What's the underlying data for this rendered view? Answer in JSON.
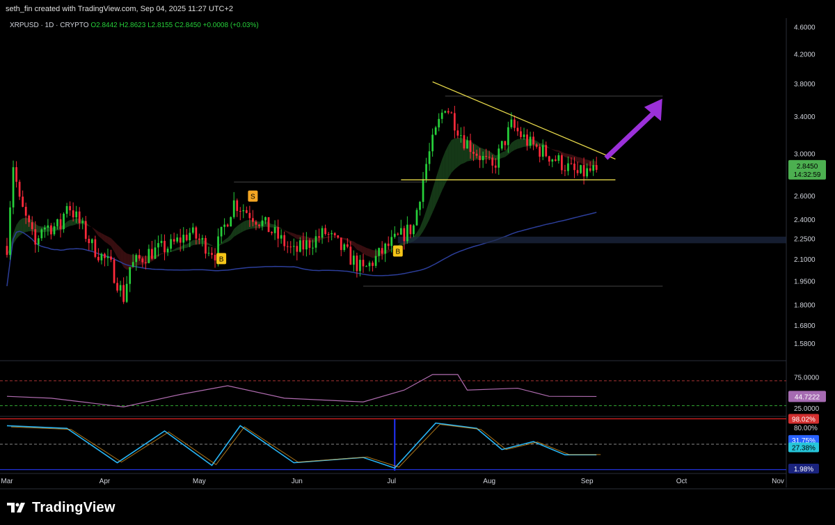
{
  "header": {
    "credit": "seth_fin created with TradingView.com, Sep 04, 2025 11:27 UTC+2"
  },
  "footer": {
    "brand": "TradingView",
    "logo_icon": "tradingview-logo-icon"
  },
  "colors": {
    "background": "#000000",
    "up": "#26d03a",
    "down": "#ff2a3b",
    "ema_fast": "#2e7d32",
    "ema_slow": "#7b1f23",
    "ma200": "#2c3e9a",
    "triangle": "#e6d84a",
    "arrow": "#9b30d9",
    "rsi_line": "#b06cb0",
    "rsi_tag_bg": "#a66bb2",
    "price_tag_bg": "#4caf50",
    "buy_signal": "#f5c518",
    "sell_signal": "#f5a623"
  },
  "chart_data": [
    {
      "type": "candlestick",
      "symbol_line": {
        "symbol": "XRPUSD · 1D · CRYPTO",
        "open": "O2.8442",
        "high": "H2.8623",
        "low": "L2.8155",
        "close": "C2.8450",
        "change": "+0.0008 (+0.03%)"
      },
      "y_scale": "log",
      "ylim": [
        1.5,
        4.75
      ],
      "y_ticks": [
        "4.6000",
        "4.2000",
        "3.8000",
        "3.4000",
        "3.0000",
        "2.6000",
        "2.4000",
        "2.2500",
        "2.1000",
        "1.9500",
        "1.8000",
        "1.6800",
        "1.5800"
      ],
      "x_ticks": [
        "Mar",
        "Apr",
        "May",
        "Jun",
        "Jul",
        "Aug",
        "Sep",
        "Oct",
        "Nov"
      ],
      "last_price": "2.8450",
      "countdown": "14:32:59",
      "signals": [
        {
          "label": "B",
          "date": "2025-05-08",
          "kind": "buy"
        },
        {
          "label": "S",
          "date": "2025-05-18",
          "kind": "sell"
        },
        {
          "label": "B",
          "date": "2025-07-03",
          "kind": "buy"
        }
      ],
      "levels": [
        2.73,
        2.25,
        1.92,
        3.65
      ],
      "closes": [
        {
          "d": "2025-03-01",
          "c": 2.2
        },
        {
          "d": "2025-03-03",
          "c": 2.9
        },
        {
          "d": "2025-03-05",
          "c": 2.55
        },
        {
          "d": "2025-03-10",
          "c": 2.2
        },
        {
          "d": "2025-03-12",
          "c": 2.35
        },
        {
          "d": "2025-03-18",
          "c": 2.35
        },
        {
          "d": "2025-03-20",
          "c": 2.55
        },
        {
          "d": "2025-03-28",
          "c": 2.2
        },
        {
          "d": "2025-04-03",
          "c": 2.05
        },
        {
          "d": "2025-04-07",
          "c": 1.85
        },
        {
          "d": "2025-04-09",
          "c": 2.05
        },
        {
          "d": "2025-04-15",
          "c": 2.15
        },
        {
          "d": "2025-04-22",
          "c": 2.2
        },
        {
          "d": "2025-04-28",
          "c": 2.3
        },
        {
          "d": "2025-05-06",
          "c": 2.15
        },
        {
          "d": "2025-05-12",
          "c": 2.55
        },
        {
          "d": "2025-05-20",
          "c": 2.4
        },
        {
          "d": "2025-05-31",
          "c": 2.15
        },
        {
          "d": "2025-06-10",
          "c": 2.3
        },
        {
          "d": "2025-06-22",
          "c": 2.02
        },
        {
          "d": "2025-06-30",
          "c": 2.2
        },
        {
          "d": "2025-07-08",
          "c": 2.35
        },
        {
          "d": "2025-07-12",
          "c": 2.9
        },
        {
          "d": "2025-07-18",
          "c": 3.55
        },
        {
          "d": "2025-07-24",
          "c": 3.15
        },
        {
          "d": "2025-08-02",
          "c": 2.85
        },
        {
          "d": "2025-08-08",
          "c": 3.3
        },
        {
          "d": "2025-08-14",
          "c": 3.1
        },
        {
          "d": "2025-08-22",
          "c": 2.95
        },
        {
          "d": "2025-08-29",
          "c": 2.8
        },
        {
          "d": "2025-09-04",
          "c": 2.845
        }
      ]
    },
    {
      "type": "line",
      "name": "RSI",
      "ylim": [
        15,
        100
      ],
      "y_ticks": [
        "75.0000",
        "25.0000"
      ],
      "current": "44.7222",
      "levels": [
        70,
        30
      ],
      "points": [
        {
          "d": "2025-03-01",
          "v": 45
        },
        {
          "d": "2025-03-15",
          "v": 42
        },
        {
          "d": "2025-04-07",
          "v": 28
        },
        {
          "d": "2025-04-25",
          "v": 48
        },
        {
          "d": "2025-05-10",
          "v": 62
        },
        {
          "d": "2025-05-28",
          "v": 42
        },
        {
          "d": "2025-06-22",
          "v": 36
        },
        {
          "d": "2025-07-05",
          "v": 55
        },
        {
          "d": "2025-07-14",
          "v": 80
        },
        {
          "d": "2025-07-22",
          "v": 80
        },
        {
          "d": "2025-07-25",
          "v": 55
        },
        {
          "d": "2025-08-10",
          "v": 58
        },
        {
          "d": "2025-08-20",
          "v": 45
        },
        {
          "d": "2025-09-04",
          "v": 44.7
        }
      ]
    },
    {
      "type": "line",
      "name": "Stochastic RSI",
      "ylim": [
        0,
        100
      ],
      "y_ticks": [
        "80.00%"
      ],
      "tags": [
        "98.02%",
        "31.75%",
        "27.38%",
        "1.98%"
      ],
      "points": [
        {
          "d": "2025-03-01",
          "v": 85
        },
        {
          "d": "2025-03-20",
          "v": 80
        },
        {
          "d": "2025-04-05",
          "v": 15
        },
        {
          "d": "2025-04-20",
          "v": 75
        },
        {
          "d": "2025-05-05",
          "v": 10
        },
        {
          "d": "2025-05-14",
          "v": 85
        },
        {
          "d": "2025-05-31",
          "v": 15
        },
        {
          "d": "2025-06-22",
          "v": 25
        },
        {
          "d": "2025-07-02",
          "v": 5
        },
        {
          "d": "2025-07-15",
          "v": 90
        },
        {
          "d": "2025-07-28",
          "v": 80
        },
        {
          "d": "2025-08-05",
          "v": 40
        },
        {
          "d": "2025-08-15",
          "v": 55
        },
        {
          "d": "2025-08-25",
          "v": 30
        },
        {
          "d": "2025-09-04",
          "v": 30
        }
      ]
    }
  ]
}
